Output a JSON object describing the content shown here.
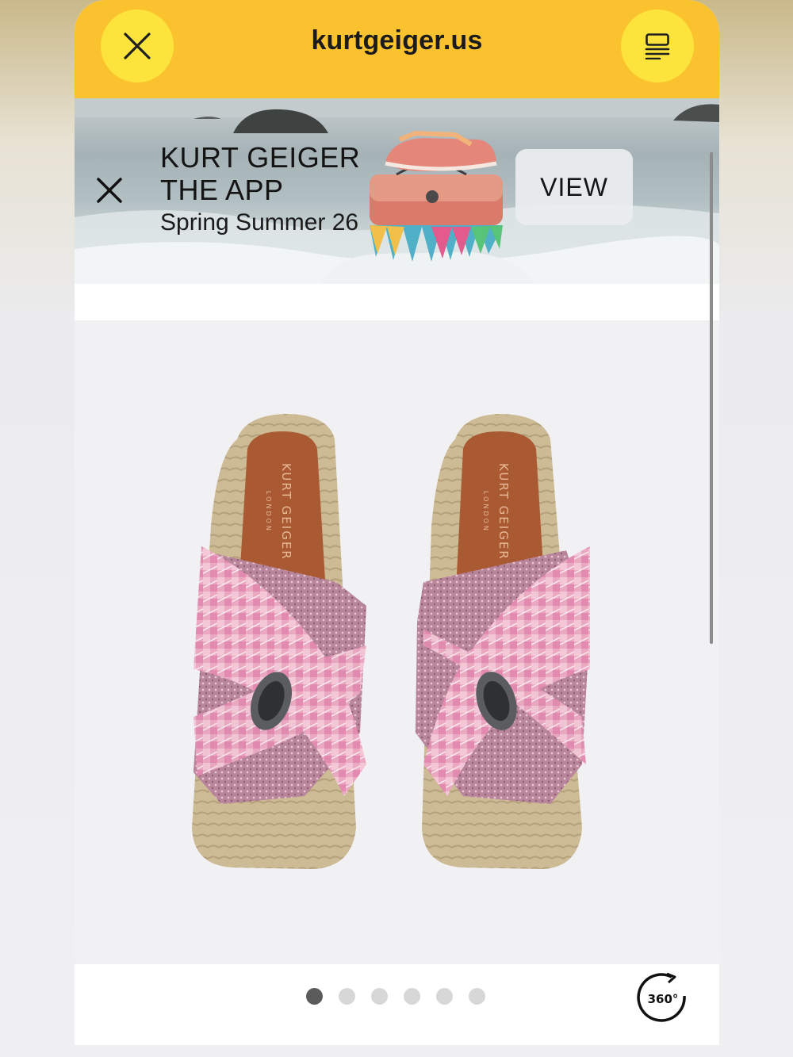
{
  "browser": {
    "url": "kurtgeiger.us",
    "close_icon": "close-icon",
    "menu_icon": "menu-icon",
    "accent_color": "#fbc22f"
  },
  "banner": {
    "title_line1": "KURT GEIGER",
    "title_line2": "THE APP",
    "subtitle": "Spring Summer 26",
    "view_label": "VIEW",
    "close_icon": "close-icon"
  },
  "product": {
    "image_alt": "Pink tweed espadrille sandals",
    "insole_brand": "KURT GEIGER",
    "insole_city": "LONDON"
  },
  "gallery": {
    "dot_count": 6,
    "active_index": 0,
    "rotate_label": "360°"
  }
}
